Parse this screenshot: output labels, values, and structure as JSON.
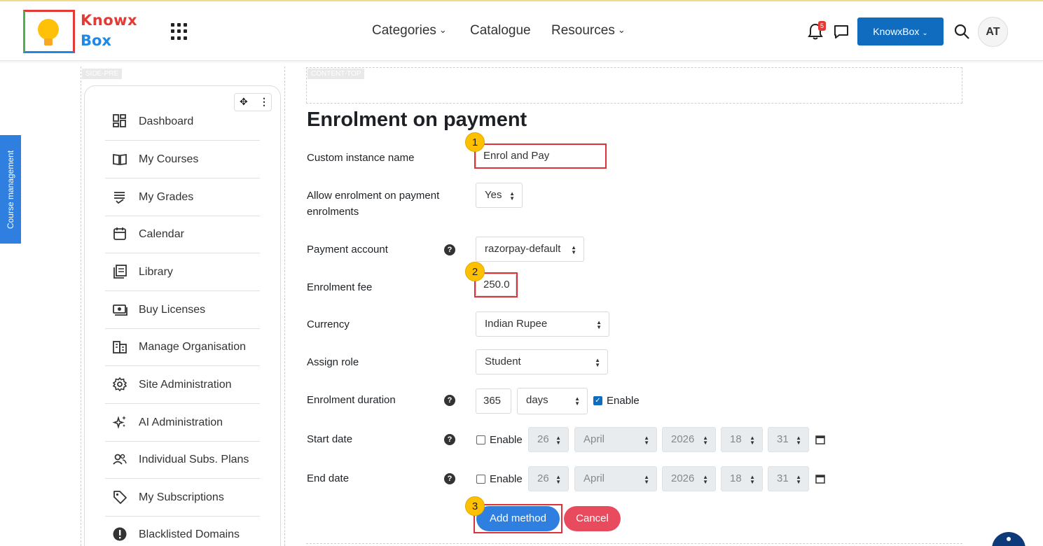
{
  "header": {
    "logo_line1": "Knowx",
    "logo_line2": "Box",
    "nav": [
      {
        "label": "Categories",
        "has_dropdown": true
      },
      {
        "label": "Catalogue",
        "has_dropdown": false
      },
      {
        "label": "Resources",
        "has_dropdown": true
      }
    ],
    "notification_count": "5",
    "brand_menu": "KnowxBox",
    "avatar_initials": "AT"
  },
  "drawer_tab": "Course management",
  "regions": {
    "side": "SIDE-PRE",
    "content": "CONTENT-TOP"
  },
  "sidebar": {
    "items": [
      {
        "label": "Dashboard",
        "icon": "dashboard-icon"
      },
      {
        "label": "My Courses",
        "icon": "book-icon"
      },
      {
        "label": "My Grades",
        "icon": "grades-icon"
      },
      {
        "label": "Calendar",
        "icon": "calendar-icon"
      },
      {
        "label": "Library",
        "icon": "library-icon"
      },
      {
        "label": "Buy Licenses",
        "icon": "money-icon"
      },
      {
        "label": "Manage Organisation",
        "icon": "organisation-icon"
      },
      {
        "label": "Site Administration",
        "icon": "gear-icon"
      },
      {
        "label": "AI Administration",
        "icon": "sparkle-icon"
      },
      {
        "label": "Individual Subs. Plans",
        "icon": "users-icon"
      },
      {
        "label": "My Subscriptions",
        "icon": "tag-icon"
      },
      {
        "label": "Blacklisted Domains",
        "icon": "alert-icon"
      }
    ]
  },
  "form": {
    "title": "Enrolment on payment",
    "custom_name": {
      "label": "Custom instance name",
      "value": "Enrol and Pay"
    },
    "allow_enrol": {
      "label": "Allow enrolment on payment enrolments",
      "value": "Yes"
    },
    "payment_account": {
      "label": "Payment account",
      "value": "razorpay-default"
    },
    "fee": {
      "label": "Enrolment fee",
      "value": "250.0"
    },
    "currency": {
      "label": "Currency",
      "value": "Indian Rupee"
    },
    "role": {
      "label": "Assign role",
      "value": "Student"
    },
    "duration": {
      "label": "Enrolment duration",
      "amount": "365",
      "unit": "days",
      "enable_label": "Enable",
      "enabled": true
    },
    "start_date": {
      "label": "Start date",
      "enable_label": "Enable",
      "enabled": false,
      "day": "26",
      "month": "April",
      "year": "2026",
      "hour": "18",
      "minute": "31"
    },
    "end_date": {
      "label": "End date",
      "enable_label": "Enable",
      "enabled": false,
      "day": "26",
      "month": "April",
      "year": "2026",
      "hour": "18",
      "minute": "31"
    },
    "submit_label": "Add method",
    "cancel_label": "Cancel"
  },
  "steps": [
    "1",
    "2",
    "3"
  ],
  "colors": {
    "primary": "#0f6cbf",
    "button_blue": "#2f7fe0",
    "cancel": "#e94b5e",
    "highlight": "#e0303a",
    "step_badge": "#ffc000"
  }
}
